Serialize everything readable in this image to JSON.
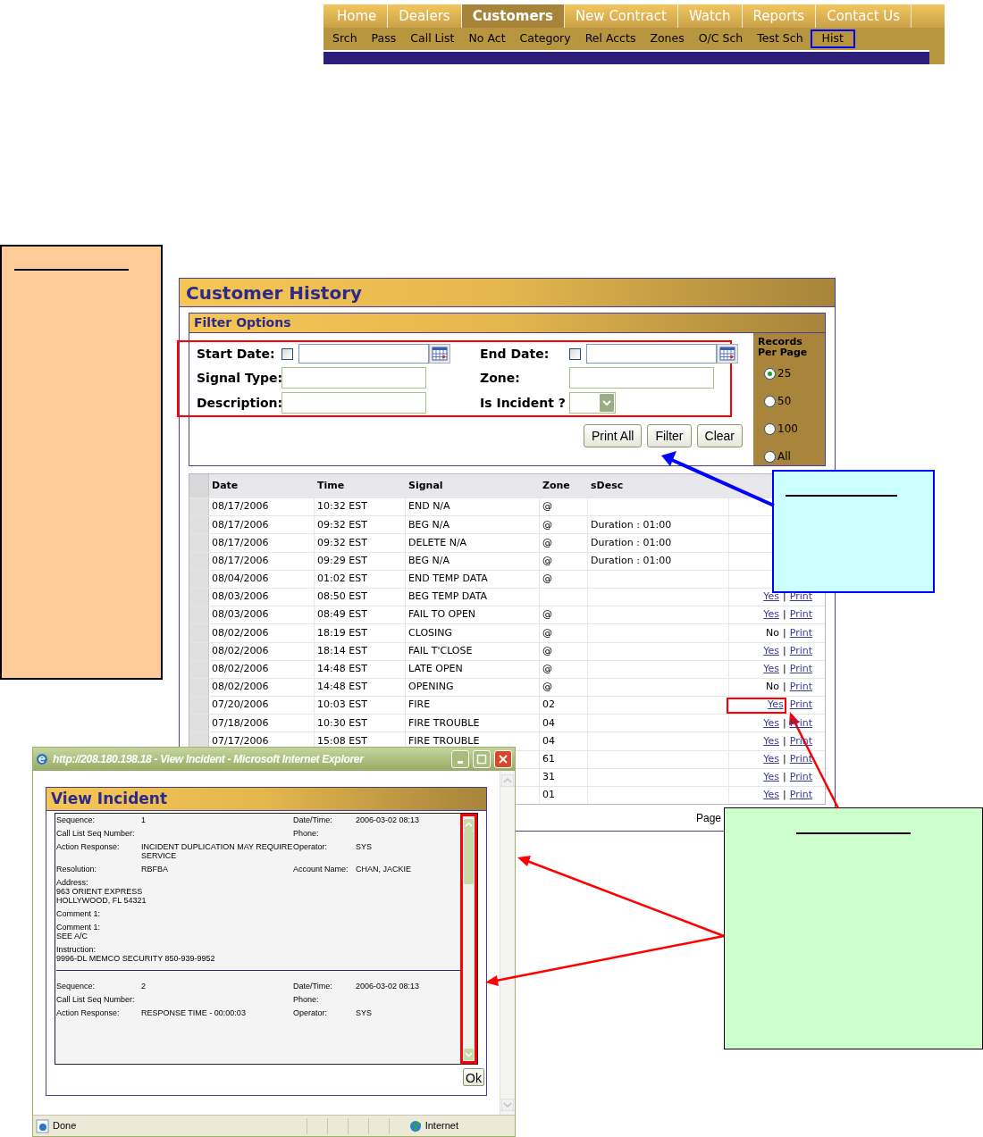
{
  "nav": {
    "tabs": [
      {
        "label": "Home",
        "selected": false
      },
      {
        "label": "Dealers",
        "selected": false
      },
      {
        "label": "Customers",
        "selected": true
      },
      {
        "label": "New Contract",
        "selected": false
      },
      {
        "label": "Watch",
        "selected": false
      },
      {
        "label": "Reports",
        "selected": false
      },
      {
        "label": "Contact Us",
        "selected": false
      }
    ],
    "subtabs": [
      {
        "label": "Srch",
        "selected": false
      },
      {
        "label": "Pass",
        "selected": false
      },
      {
        "label": "Call List",
        "selected": false
      },
      {
        "label": "No Act",
        "selected": false
      },
      {
        "label": "Category",
        "selected": false
      },
      {
        "label": "Rel Accts",
        "selected": false
      },
      {
        "label": "Zones",
        "selected": false
      },
      {
        "label": "O/C Sch",
        "selected": false
      },
      {
        "label": "Test Sch",
        "selected": false
      },
      {
        "label": "Hist",
        "selected": true
      }
    ]
  },
  "customer_history": {
    "title": "Customer History",
    "filter": {
      "title": "Filter Options",
      "highlighted": true,
      "fields": [
        {
          "label": "Start Date:",
          "kind": "date",
          "checked": false
        },
        {
          "label": "End Date:",
          "kind": "date",
          "checked": false
        },
        {
          "label": "Signal Type:",
          "kind": "text"
        },
        {
          "label": "Zone:",
          "kind": "text"
        },
        {
          "label": "Description:",
          "kind": "text"
        },
        {
          "label": "Is Incident ?",
          "kind": "select"
        }
      ],
      "buttons": [
        "Print All",
        "Filter",
        "Clear"
      ],
      "records_per_page": {
        "label": "Records Per Page",
        "options": [
          {
            "label": "25",
            "selected": true
          },
          {
            "label": "50",
            "selected": false
          },
          {
            "label": "100",
            "selected": false
          },
          {
            "label": "All",
            "selected": false
          }
        ]
      }
    },
    "table": {
      "columns": [
        "Date",
        "Time",
        "Signal",
        "Zone",
        "sDesc"
      ],
      "rows": [
        {
          "date": "08/17/2006",
          "time": "10:32 EST",
          "signal": "END N/A",
          "zone": "@"
        },
        {
          "date": "08/17/2006",
          "time": "09:32 EST",
          "signal": "BEG N/A",
          "zone": "@",
          "desc": "Duration : 01:00"
        },
        {
          "date": "08/17/2006",
          "time": "09:32 EST",
          "signal": "DELETE N/A",
          "zone": "@",
          "desc": "Duration : 01:00"
        },
        {
          "date": "08/17/2006",
          "time": "09:29 EST",
          "signal": "BEG N/A",
          "zone": "@",
          "desc": "Duration : 01:00"
        },
        {
          "date": "08/04/2006",
          "time": "01:02 EST",
          "signal": "END TEMP DATA",
          "zone": "@"
        },
        {
          "date": "08/03/2006",
          "time": "08:50 EST",
          "signal": "BEG TEMP DATA",
          "incident": "Yes",
          "incident_link": true,
          "separator": "|",
          "print": "Print",
          "outlined": false
        },
        {
          "date": "08/03/2006",
          "time": "08:49 EST",
          "signal": "FAIL TO OPEN",
          "zone": "@",
          "incident": "Yes",
          "incident_link": true,
          "separator": "|",
          "print": "Print",
          "outlined": false
        },
        {
          "date": "08/02/2006",
          "time": "18:19 EST",
          "signal": "CLOSING",
          "zone": "@",
          "incident": "No",
          "incident_link": false,
          "separator": "|",
          "print": "Print",
          "outlined": false
        },
        {
          "date": "08/02/2006",
          "time": "18:14 EST",
          "signal": "FAIL T'CLOSE",
          "zone": "@",
          "incident": "Yes",
          "incident_link": true,
          "separator": "|",
          "print": "Print",
          "outlined": false
        },
        {
          "date": "08/02/2006",
          "time": "14:48 EST",
          "signal": "LATE OPEN",
          "zone": "@",
          "incident": "Yes",
          "incident_link": true,
          "separator": "|",
          "print": "Print",
          "outlined": false
        },
        {
          "date": "08/02/2006",
          "time": "14:48 EST",
          "signal": "OPENING",
          "zone": "@",
          "incident": "No",
          "incident_link": false,
          "separator": "|",
          "print": "Print",
          "outlined": false
        },
        {
          "date": "07/20/2006",
          "time": "10:03 EST",
          "signal": "FIRE",
          "zone": "02",
          "incident": "Yes",
          "incident_link": true,
          "print": "Print",
          "outlined": true
        },
        {
          "date": "07/18/2006",
          "time": "10:30 EST",
          "signal": "FIRE TROUBLE",
          "zone": "04",
          "incident": "Yes",
          "incident_link": true,
          "separator": "|",
          "print": "Print",
          "outlined": false
        },
        {
          "date": "07/17/2006",
          "time": "15:08 EST",
          "signal": "FIRE TROUBLE",
          "zone": "04",
          "incident": "Yes",
          "incident_link": true,
          "separator": "|",
          "print": "Print",
          "outlined": false
        },
        {
          "zone": "61",
          "incident": "Yes",
          "incident_link": true,
          "separator": "|",
          "print": "Print",
          "outlined": false
        },
        {
          "zone": "31",
          "incident": "Yes",
          "incident_link": true,
          "separator": "|",
          "print": "Print",
          "outlined": false
        },
        {
          "zone": "01",
          "incident": "Yes",
          "incident_link": true,
          "separator": "|",
          "print": "Print",
          "outlined": false
        }
      ]
    },
    "pager": {
      "label": "Page"
    }
  },
  "popup": {
    "title": "http://208.180.198.18 - View Incident - Microsoft Internet Explorer",
    "heading": "View Incident",
    "scrollbar_highlighted": true,
    "records": [
      {
        "fields": [
          {
            "label": "Sequence:",
            "value": "1",
            "kind": "pair"
          },
          {
            "label": "Date/Time:",
            "value": "2006-03-02 08:13",
            "kind": "pair"
          },
          {
            "label": "Call List Seq Number:",
            "kind": "pair"
          },
          {
            "label": "Phone:",
            "kind": "pair"
          },
          {
            "label": "Action Response:",
            "value": "INCIDENT DUPLICATION MAY REQUIRE SERVICE",
            "kind": "pair"
          },
          {
            "label": "Operator:",
            "value": "SYS",
            "kind": "pair"
          },
          {
            "label": "Resolution:",
            "value": "RBFBA",
            "kind": "pair"
          },
          {
            "label": "Account Name:",
            "value": "CHAN, JACKIE",
            "kind": "pair"
          },
          {
            "label": "Address:",
            "value": "963 ORIENT EXPRESS\nHOLLYWOOD, FL 54321",
            "kind": "block"
          },
          {
            "label": "Comment 1:",
            "kind": "block"
          },
          {
            "label": "Comment 1:",
            "value": "SEE A/C",
            "kind": "block"
          },
          {
            "label": "Instruction:",
            "value": "9996-DL MEMCO SECURITY 850-939-9952",
            "kind": "block"
          }
        ]
      },
      {
        "fields": [
          {
            "label": "Sequence:",
            "value": "2",
            "kind": "pair"
          },
          {
            "label": "Date/Time:",
            "value": "2006-03-02 08:13",
            "kind": "pair"
          },
          {
            "label": "Call List Seq Number:",
            "kind": "pair"
          },
          {
            "label": "Phone:",
            "kind": "pair"
          },
          {
            "label": "Action Response:",
            "value": "RESPONSE TIME - 00:00:03",
            "kind": "pair"
          },
          {
            "label": "Operator:",
            "value": "SYS",
            "kind": "pair"
          }
        ]
      }
    ],
    "ok_button": "Ok",
    "status": "Done",
    "zone": "Internet"
  },
  "callouts": [
    {
      "color": "#ffcc99"
    },
    {
      "color": "#ccffff"
    },
    {
      "color": "#ccffcc"
    }
  ]
}
